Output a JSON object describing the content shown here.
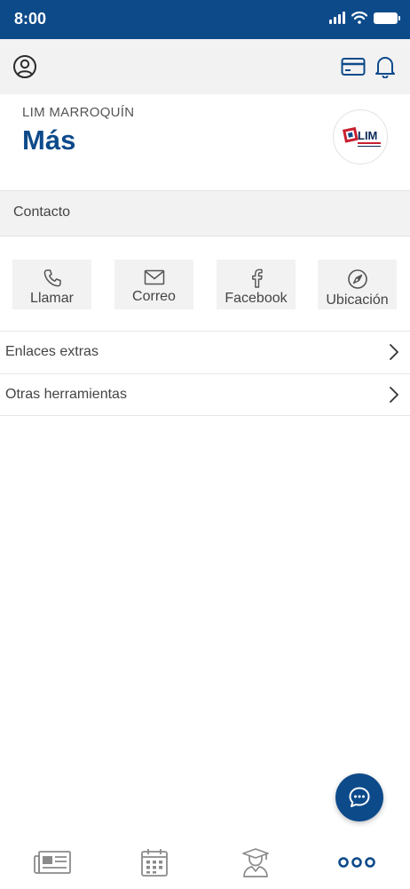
{
  "status_bar": {
    "time": "8:00"
  },
  "header": {
    "kicker": "LIM MARROQUÍN",
    "title": "Más"
  },
  "logo": {
    "text": "LIM"
  },
  "contact_section": {
    "title": "Contacto",
    "buttons": [
      {
        "label": "Llamar",
        "icon": "phone-icon"
      },
      {
        "label": "Correo",
        "icon": "mail-icon"
      },
      {
        "label": "Facebook",
        "icon": "facebook-icon"
      },
      {
        "label": "Ubicación",
        "icon": "compass-icon"
      }
    ]
  },
  "list": [
    {
      "label": "Enlaces extras"
    },
    {
      "label": "Otras herramientas"
    }
  ],
  "tabs": [
    {
      "icon": "news-icon"
    },
    {
      "icon": "calendar-icon"
    },
    {
      "icon": "graduate-icon"
    },
    {
      "icon": "more-icon"
    }
  ],
  "colors": {
    "primary": "#0d4a8a",
    "panel": "#f2f2f2",
    "icon_gray": "#8a8a8a"
  }
}
